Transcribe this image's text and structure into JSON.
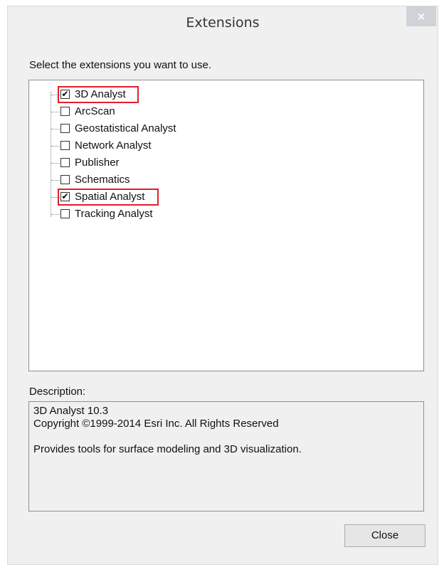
{
  "window": {
    "title": "Extensions",
    "close_glyph": "×"
  },
  "instruction": "Select the extensions you want to use.",
  "extensions": [
    {
      "label": "3D Analyst",
      "checked": true,
      "highlighted": true
    },
    {
      "label": "ArcScan",
      "checked": false,
      "highlighted": false
    },
    {
      "label": "Geostatistical Analyst",
      "checked": false,
      "highlighted": false
    },
    {
      "label": "Network Analyst",
      "checked": false,
      "highlighted": false
    },
    {
      "label": "Publisher",
      "checked": false,
      "highlighted": false
    },
    {
      "label": "Schematics",
      "checked": false,
      "highlighted": false
    },
    {
      "label": "Spatial Analyst",
      "checked": true,
      "highlighted": true
    },
    {
      "label": "Tracking Analyst",
      "checked": false,
      "highlighted": false
    }
  ],
  "description": {
    "label": "Description:",
    "line1": "3D Analyst 10.3",
    "line2": "Copyright ©1999-2014 Esri Inc. All Rights Reserved",
    "line3": "Provides tools for surface modeling and 3D visualization."
  },
  "buttons": {
    "close": "Close"
  },
  "colors": {
    "highlight": "#e0202a",
    "background": "#f0f0f0"
  },
  "check_glyph": "✔"
}
